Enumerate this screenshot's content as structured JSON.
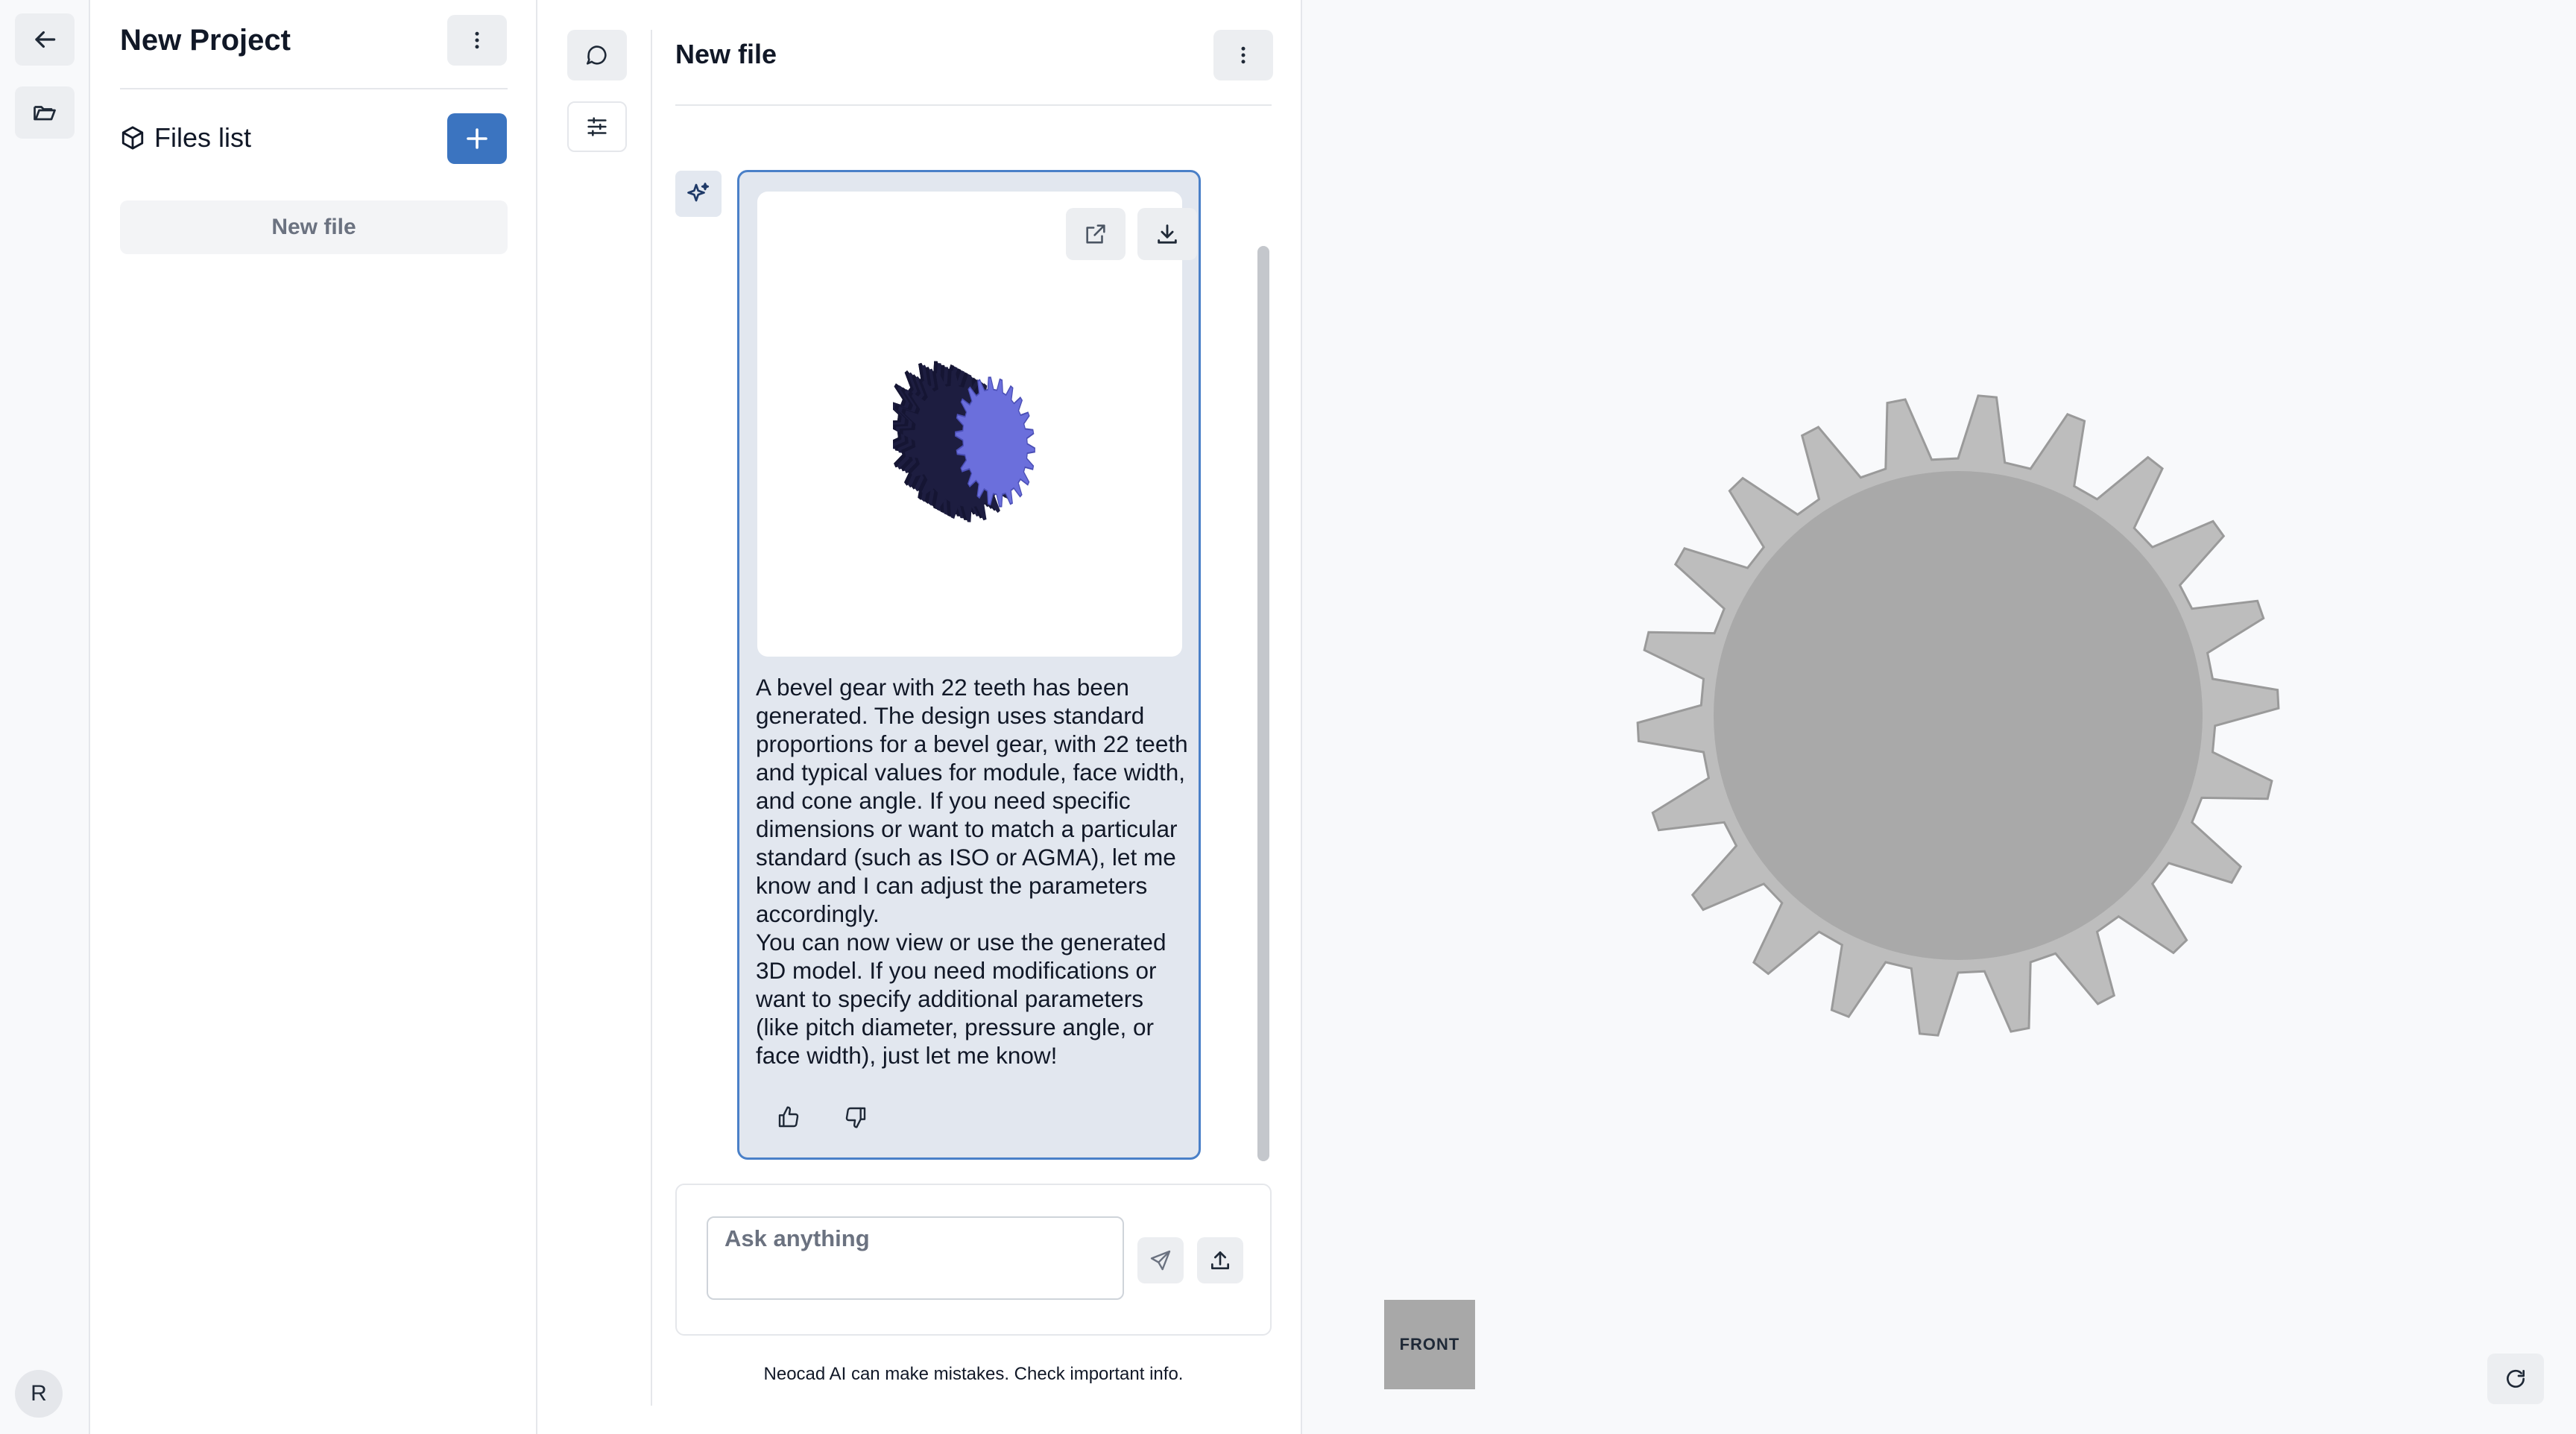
{
  "rail": {
    "icons": [
      "arrow-left-icon",
      "folder-open-icon"
    ],
    "avatar_initial": "R"
  },
  "files_panel": {
    "project_title": "New Project",
    "files_list_label": "Files list",
    "files": [
      "New file"
    ]
  },
  "chat": {
    "title": "New file",
    "message_paragraphs": [
      "A bevel gear with 22 teeth has been generated. The design uses standard proportions for a bevel gear, with 22 teeth and typical values for module, face width, and cone angle. If you need specific dimensions or want to match a particular standard (such as ISO or AGMA), let me know and I can adjust the parameters accordingly.",
      "You can now view or use the generated 3D model. If you need modifications or want to specify additional parameters (like pitch diameter, pressure angle, or face width), just let me know!"
    ],
    "input_placeholder": "Ask anything",
    "disclaimer": "Neocad AI can make mistakes. Check important info."
  },
  "viewport": {
    "view_cube_label": "FRONT"
  },
  "colors": {
    "accent": "#3b74c0",
    "card_border": "#4a80c8",
    "card_bg": "#e2e7ef",
    "gear_face": "#6b6fdc",
    "gear_gray": "#a9a9a9"
  }
}
